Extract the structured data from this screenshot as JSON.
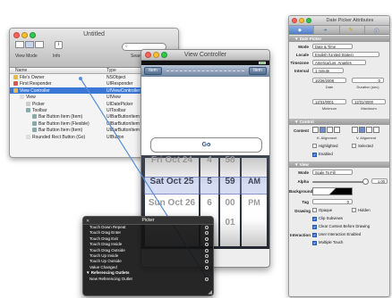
{
  "untitled": {
    "title": "Untitled",
    "view_mode_label": "View Mode",
    "info_label": "Info",
    "search_label": "Search Field",
    "columns": [
      "Name",
      "Type"
    ],
    "rows": [
      {
        "name": "File's Owner",
        "type": "NSObject",
        "indent": 0,
        "color": "#e6b84d"
      },
      {
        "name": "First Responder",
        "type": "UIResponder",
        "indent": 0,
        "color": "#d55"
      },
      {
        "name": "View Controller",
        "type": "UIViewController",
        "indent": 0,
        "color": "#e6b84d",
        "selected": true
      },
      {
        "name": "View",
        "type": "UIView",
        "indent": 1,
        "color": "#ddd"
      },
      {
        "name": "Picker",
        "type": "UIDatePicker",
        "indent": 2,
        "color": "#ccc"
      },
      {
        "name": "Toolbar",
        "type": "UIToolbar",
        "indent": 2,
        "color": "#8aa"
      },
      {
        "name": "Bar Button Item (Item)",
        "type": "UIBarButtonItem",
        "indent": 3,
        "color": "#8aa"
      },
      {
        "name": "Bar Button Item (Flexible)",
        "type": "UIBarButtonItem",
        "indent": 3,
        "color": "#8aa"
      },
      {
        "name": "Bar Button Item (Item)",
        "type": "UIBarButtonItem",
        "indent": 3,
        "color": "#8aa"
      },
      {
        "name": "Rounded Rect Button (Go)",
        "type": "UIButton",
        "indent": 2,
        "color": "#ddd"
      }
    ]
  },
  "view_controller": {
    "title": "View Controller",
    "nav_left": "Item",
    "nav_right": "Item",
    "go_label": "Go",
    "picker": {
      "dates": [
        "Fri Oct 24",
        "Sat Oct 25",
        "Sun Oct 26"
      ],
      "hours": [
        "4",
        "5",
        "6",
        "7"
      ],
      "minutes": [
        "58",
        "59",
        "00",
        "01"
      ],
      "ampm": [
        "AM",
        "PM"
      ]
    }
  },
  "hud": {
    "title": "Picker",
    "events": [
      "Touch Down Repeat",
      "Touch Drag Enter",
      "Touch Drag Exit",
      "Touch Drag Inside",
      "Touch Drag Outside",
      "Touch Up Inside",
      "Touch Up Outside",
      "Value Changed"
    ],
    "ref_section": "Referencing Outlets",
    "ref_new": "New Referencing Outlet"
  },
  "inspector": {
    "title": "Date Picker Attributes",
    "sections": {
      "date_picker": "Date Picker",
      "control": "Control",
      "view": "View"
    },
    "mode_label": "Mode",
    "mode_value": "Date & Time",
    "locale_label": "Locale",
    "locale_value": "English (United States)",
    "timezone_label": "Timezone",
    "timezone_value": "America/Los_Angeles",
    "interval_label": "Interval",
    "interval_value": "1 minute",
    "date_value": "10/26/2008",
    "duration_value": "0",
    "date_caption": "Date",
    "duration_caption": "Duration (sec)",
    "min_value": "12/31/0001",
    "max_value": "12/31/4000",
    "min_caption": "Minimum",
    "max_caption": "Maximum",
    "content_label": "Content",
    "h_align_caption": "H. Alignment",
    "v_align_caption": "V. Alignment",
    "highlighted_label": "Highlighted",
    "selected_label": "Selected",
    "enabled_label": "Enabled",
    "view_mode_label": "Mode",
    "view_mode_value": "Scale To Fill",
    "alpha_label": "Alpha",
    "alpha_value": "1.00",
    "background_label": "Background",
    "tag_label": "Tag",
    "tag_value": "0",
    "drawing_label": "Drawing",
    "opaque_label": "Opaque",
    "hidden_label": "Hidden",
    "clip_label": "Clip Subviews",
    "clear_ctx_label": "Clear Context Before Drawing",
    "interaction_label": "Interaction",
    "user_interaction_label": "User Interaction Enabled",
    "multiple_touch_label": "Multiple Touch"
  },
  "colors": {
    "selection": "#3b78d6",
    "connection_line": "#5a8fd6"
  }
}
